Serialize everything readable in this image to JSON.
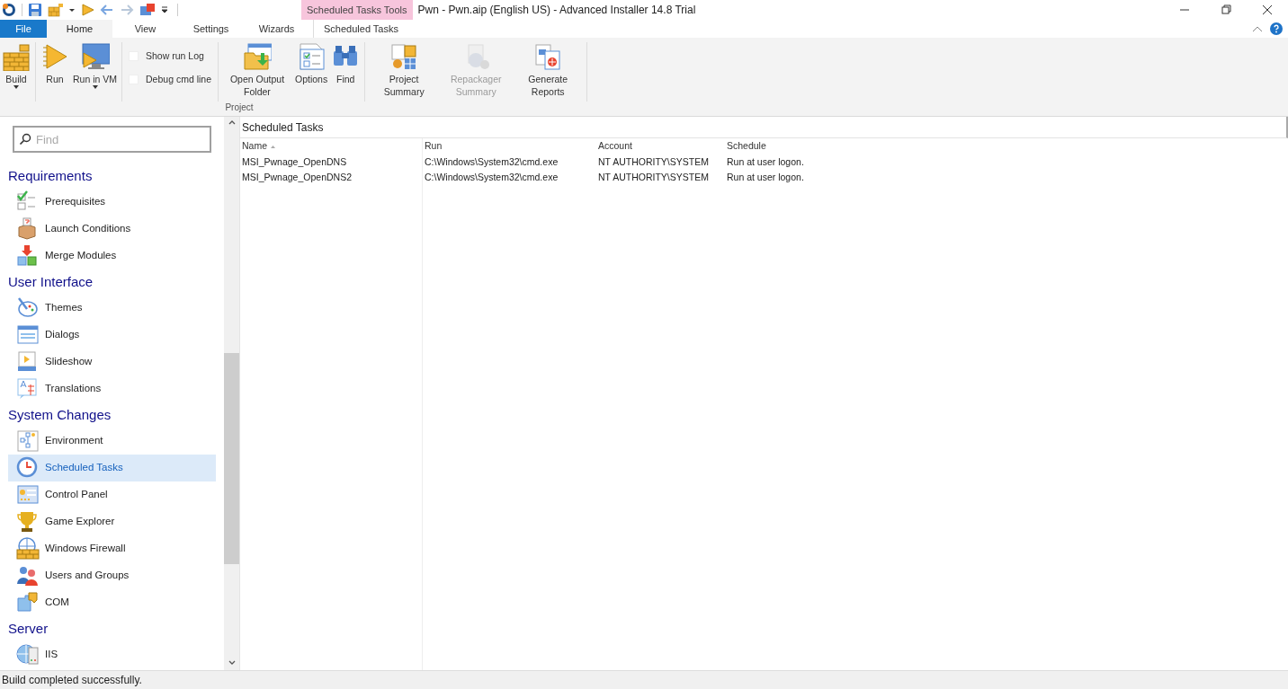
{
  "title_bar": {
    "contextual_tab": "Scheduled Tasks Tools",
    "title": "Pwn - Pwn.aip (English US) - Advanced Installer 14.8 Trial"
  },
  "tabs": [
    {
      "label": "File",
      "kind": "file",
      "selected": false
    },
    {
      "label": "Home",
      "kind": "tab",
      "selected": true
    },
    {
      "label": "View",
      "kind": "tab",
      "selected": false
    },
    {
      "label": "Settings",
      "kind": "tab",
      "selected": false
    },
    {
      "label": "Wizards",
      "kind": "tab",
      "selected": false
    },
    {
      "label": "Scheduled Tasks",
      "kind": "context",
      "selected": false
    }
  ],
  "ribbon": {
    "group": "Project",
    "items": [
      {
        "kind": "big",
        "label": "Build",
        "dropdown": true,
        "disabled": false
      },
      {
        "kind": "separator"
      },
      {
        "kind": "big",
        "label": "Run",
        "dropdown": false,
        "disabled": false
      },
      {
        "kind": "big",
        "label": "Run in VM",
        "dropdown": true,
        "disabled": false
      },
      {
        "kind": "separator"
      },
      {
        "kind": "checks",
        "checks": [
          {
            "label": "Show run Log",
            "checked": false
          },
          {
            "label": "Debug cmd line",
            "checked": false
          }
        ]
      },
      {
        "kind": "separator"
      },
      {
        "kind": "big",
        "label": "Open Output Folder",
        "dropdown": false,
        "disabled": false
      },
      {
        "kind": "big",
        "label": "Options",
        "dropdown": false,
        "disabled": false
      },
      {
        "kind": "big",
        "label": "Find",
        "dropdown": false,
        "disabled": false
      },
      {
        "kind": "separator"
      },
      {
        "kind": "big",
        "label": "Project Summary",
        "dropdown": false,
        "disabled": false
      },
      {
        "kind": "big",
        "label": "Repackager Summary",
        "dropdown": false,
        "disabled": true
      },
      {
        "kind": "big",
        "label": "Generate Reports",
        "dropdown": false,
        "disabled": false
      },
      {
        "kind": "separator"
      }
    ]
  },
  "sidebar": {
    "search": {
      "placeholder": "Find"
    },
    "sections": [
      {
        "title": "Requirements",
        "items": [
          {
            "label": "Prerequisites",
            "selected": false
          },
          {
            "label": "Launch Conditions",
            "selected": false
          },
          {
            "label": "Merge Modules",
            "selected": false
          }
        ]
      },
      {
        "title": "User Interface",
        "items": [
          {
            "label": "Themes",
            "selected": false
          },
          {
            "label": "Dialogs",
            "selected": false
          },
          {
            "label": "Slideshow",
            "selected": false
          },
          {
            "label": "Translations",
            "selected": false
          }
        ]
      },
      {
        "title": "System Changes",
        "items": [
          {
            "label": "Environment",
            "selected": false
          },
          {
            "label": "Scheduled Tasks",
            "selected": true
          },
          {
            "label": "Control Panel",
            "selected": false
          },
          {
            "label": "Game Explorer",
            "selected": false
          },
          {
            "label": "Windows Firewall",
            "selected": false
          },
          {
            "label": "Users and Groups",
            "selected": false
          },
          {
            "label": "COM",
            "selected": false
          }
        ]
      },
      {
        "title": "Server",
        "items": [
          {
            "label": "IIS",
            "selected": false
          }
        ]
      }
    ]
  },
  "content": {
    "title": "Scheduled Tasks",
    "columns": [
      "Name",
      "Run",
      "Account",
      "Schedule"
    ],
    "rows": [
      [
        "MSI_Pwnage_OpenDNS",
        "C:\\Windows\\System32\\cmd.exe",
        "NT AUTHORITY\\SYSTEM",
        "Run at user logon."
      ],
      [
        "MSI_Pwnage_OpenDNS2",
        "C:\\Windows\\System32\\cmd.exe",
        "NT AUTHORITY\\SYSTEM",
        "Run at user logon."
      ]
    ]
  },
  "status_bar": {
    "text": "Build completed successfully."
  }
}
